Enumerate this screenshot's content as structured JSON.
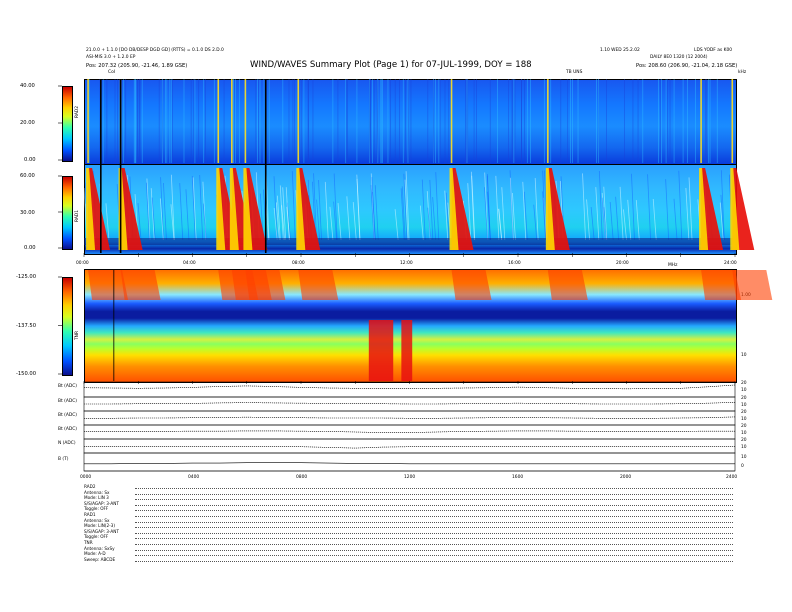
{
  "header": {
    "title": "WIND/WAVES Summary Plot (Page 1) for 07-JUL-1999, DOY = 188",
    "left_line1": "21.0.0 + 1.1.0 [DO DB/DESP DGD GD] (RTTS) = 0.1.0 DS 2.D.0",
    "left_line2": "ASI-MIS 3.0 + 1.2.0 EP",
    "left_pos": "Pos:   207.32 (205.90, -21.46, 1.89 GSE)",
    "right_line1": "1.10 WED 25.2.02",
    "right_line2": "LDS YODF as K00",
    "right_line3": "DAILY 8E0 1320 (12 2004)",
    "right_pos": "Pos:   208.60 (206.90, -21.04, 2.18 GSE)",
    "marker_label": "CoI",
    "tnr_label": "TB UNS",
    "freq_unit": "kHz",
    "rad1_unit": "MHz"
  },
  "chart_data": {
    "type": "heatmap",
    "x_range_hours": [
      0,
      24
    ],
    "colors": {
      "low": "#0a0f8c",
      "mid": "#30ffb0",
      "high": "#c80000"
    },
    "panels": [
      {
        "name": "RAD2",
        "ticks": [
          "40.00",
          "20.00",
          "0.00"
        ]
      },
      {
        "name": "RAD1",
        "ticks": [
          "60.00",
          "30.00",
          "0.00"
        ]
      },
      {
        "name": "TNR",
        "ticks": [
          "-125.00",
          "-137.50",
          "-150.00"
        ],
        "right_ticks": [
          "1.00",
          "10"
        ]
      }
    ],
    "time_ticks": [
      "00:00",
      "04:00",
      "08:00",
      "12:00",
      "16:00",
      "20:00",
      "24:00"
    ],
    "time_ticks_bottom": [
      "0000",
      "0400",
      "0800",
      "1200",
      "1600",
      "2000",
      "2400"
    ],
    "bursts_hours": [
      0.15,
      1.35,
      4.95,
      5.45,
      5.95,
      7.9,
      13.55,
      17.1,
      22.75,
      23.9
    ],
    "line_panels": [
      {
        "label": "Bt (ADC)",
        "right_ticks": [
          "20",
          "10"
        ],
        "values": [
          0.62,
          0.6,
          0.58,
          0.6,
          0.64,
          0.7,
          0.74,
          0.7,
          0.64,
          0.6,
          0.58,
          0.56,
          0.56,
          0.58,
          0.6,
          0.62,
          0.66,
          0.62,
          0.58,
          0.56,
          0.55,
          0.56,
          0.58,
          0.68,
          0.8
        ]
      },
      {
        "label": "Bt (ADC)",
        "right_ticks": [
          "20",
          "10"
        ],
        "values": [
          0.5,
          0.5,
          0.52,
          0.52,
          0.54,
          0.58,
          0.6,
          0.58,
          0.56,
          0.54,
          0.52,
          0.52,
          0.5,
          0.5,
          0.52,
          0.54,
          0.56,
          0.54,
          0.52,
          0.5,
          0.5,
          0.5,
          0.52,
          0.56,
          0.62
        ]
      },
      {
        "label": "Bt (ADC)",
        "right_ticks": [
          "20",
          "10"
        ],
        "values": [
          0.48,
          0.48,
          0.5,
          0.5,
          0.52,
          0.54,
          0.56,
          0.54,
          0.52,
          0.5,
          0.5,
          0.5,
          0.48,
          0.48,
          0.5,
          0.52,
          0.54,
          0.52,
          0.5,
          0.48,
          0.48,
          0.48,
          0.5,
          0.52,
          0.58
        ]
      },
      {
        "label": "Bt (ADC)",
        "right_ticks": [
          "20",
          "10"
        ],
        "values": [
          0.55,
          0.55,
          0.55,
          0.55,
          0.56,
          0.56,
          0.58,
          0.58,
          0.56,
          0.54,
          0.5,
          0.46,
          0.46,
          0.5,
          0.54,
          0.56,
          0.58,
          0.58,
          0.56,
          0.55,
          0.55,
          0.55,
          0.55,
          0.56,
          0.56
        ]
      },
      {
        "label": "N (ADC)",
        "right_ticks": [
          "20",
          "10"
        ],
        "values": [
          0.45,
          0.45,
          0.45,
          0.45,
          0.45,
          0.45,
          0.45,
          0.45,
          0.45,
          0.4,
          0.35,
          0.42,
          0.45,
          0.45,
          0.45,
          0.45,
          0.45,
          0.45,
          0.45,
          0.45,
          0.45,
          0.45,
          0.45,
          0.45,
          0.45
        ]
      },
      {
        "label": "B (T)",
        "right_ticks": [
          "10",
          "0"
        ],
        "values": [
          0.4,
          0.4,
          0.42,
          0.42,
          0.44,
          0.44,
          0.46,
          0.46,
          0.46,
          0.44,
          0.42,
          0.42,
          0.4,
          0.4,
          0.4,
          0.4,
          0.4,
          0.4,
          0.4,
          0.4,
          0.4,
          0.4,
          0.4,
          0.4,
          0.4
        ]
      }
    ]
  },
  "info_rows": [
    "RAD2",
    "Antenna:    Sx",
    "Mode:    LIN 3",
    "S/S/AGAP:  3-ANT",
    "Toggle:    OFF",
    "RAD1",
    "Antenna:    Sx",
    "Mode:    LIN(2-3)",
    "S/S/AGAP:  3-ANT",
    "Toggle:    OFF",
    "TNR",
    "Antenna:   SxSy",
    "Mode:    A-D",
    "Sweep:   ABCDE"
  ]
}
